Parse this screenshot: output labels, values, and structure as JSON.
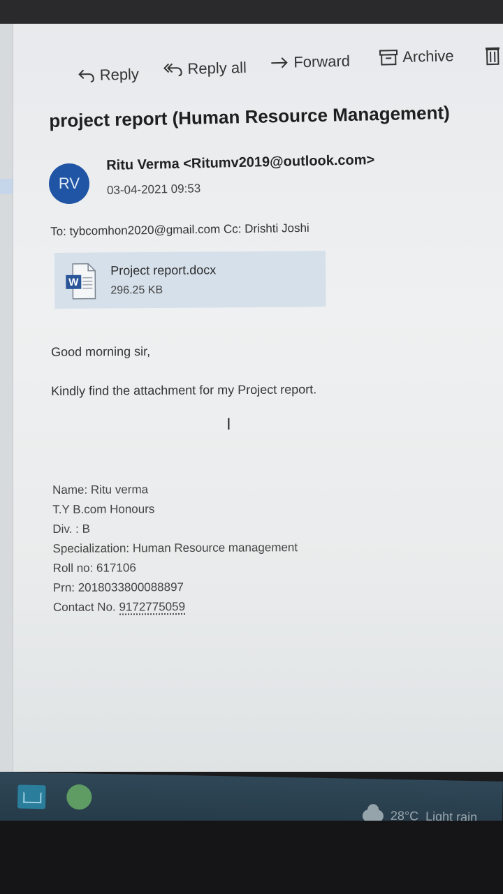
{
  "toolbar": {
    "reply": "Reply",
    "reply_all": "Reply all",
    "forward": "Forward",
    "archive": "Archive"
  },
  "message": {
    "subject": "project report (Human Resource Management)",
    "avatar_initials": "RV",
    "sender": "Ritu Verma <Ritumv2019@outlook.com>",
    "datetime": "03-04-2021 09:53",
    "recipients": "To: tybcomhon2020@gmail.com Cc: Drishti Joshi"
  },
  "attachment": {
    "icon": "word-doc-icon",
    "icon_letter": "W",
    "filename": "Project report.docx",
    "size": "296.25 KB"
  },
  "body": {
    "greeting": "Good morning sir,",
    "line1": "Kindly find the attachment for my Project report."
  },
  "signature": {
    "name": "Name: Ritu verma",
    "course": "T.Y B.com Honours",
    "division": "Div. : B",
    "specialization": "Specialization: Human Resource management",
    "roll": "Roll no: 617106",
    "prn": "Prn: 2018033800088897",
    "contact_label": "Contact No.",
    "contact_number": "9172775059"
  },
  "taskbar": {
    "temperature": "28°C",
    "weather": "Light rain"
  },
  "colors": {
    "avatar": "#1f55a4",
    "attachment_bg": "#d6e0ea",
    "taskbar": "#2f4757"
  }
}
